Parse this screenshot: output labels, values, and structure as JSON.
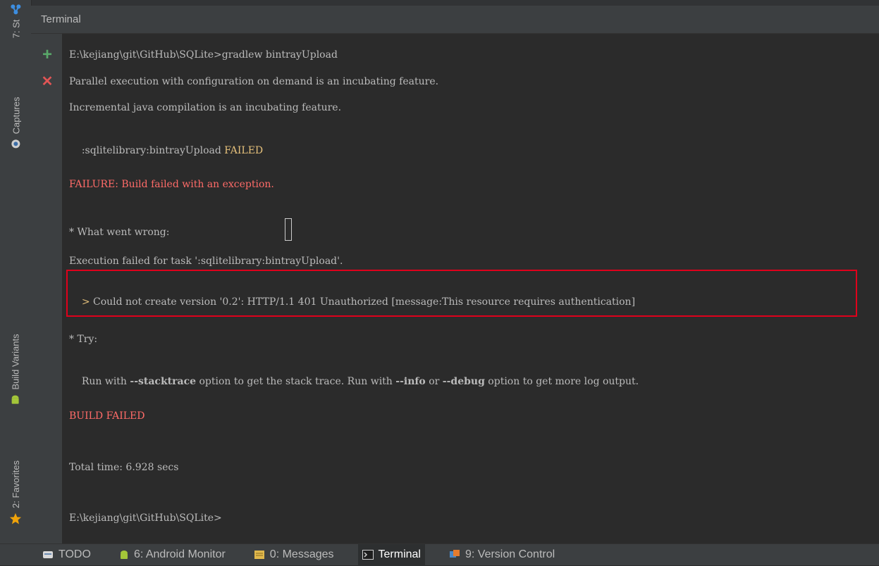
{
  "left_stripe": {
    "structure_tab": "7: St",
    "captures_tab": "Captures",
    "build_variants_tab": "Build Variants",
    "favorites_tab": "2: Favorites"
  },
  "terminal": {
    "title": "Terminal",
    "actions": {
      "new_session": "+",
      "close_session": "✕"
    },
    "lines": {
      "l1": "E:\\kejiang\\git\\GitHub\\SQLite>gradlew bintrayUpload",
      "l2": "Parallel execution with configuration on demand is an incubating feature.",
      "l3": "Incremental java compilation is an incubating feature.",
      "l4_task": ":sqlitelibrary:bintrayUpload ",
      "l4_status": "FAILED",
      "l5": "FAILURE: Build failed with an exception.",
      "l6": "* What went wrong:",
      "l7": "Execution failed for task ':sqlitelibrary:bintrayUpload'.",
      "l8_prefix": "> ",
      "l8": "Could not create version '0.2': HTTP/1.1 401 Unauthorized [message:This resource requires authentication]",
      "l9": "* Try:",
      "l10_a": "Run with ",
      "l10_b": "--stacktrace",
      "l10_c": " option to get the stack trace. Run with ",
      "l10_d": "--info",
      "l10_e": " or ",
      "l10_f": "--debug",
      "l10_g": " option to get more log output.",
      "l11": "BUILD FAILED",
      "l12": "Total time: 6.928 secs",
      "l13": "E:\\kejiang\\git\\GitHub\\SQLite>"
    }
  },
  "bottom_bar": {
    "tabs": [
      {
        "label": "TODO"
      },
      {
        "label": "6: Android Monitor"
      },
      {
        "label": "0: Messages"
      },
      {
        "label": "Terminal"
      },
      {
        "label": "9: Version Control"
      }
    ]
  },
  "colors": {
    "background": "#2b2b2b",
    "panel": "#3c3f41",
    "error_red": "#ff6b68",
    "failed_yellow": "#e5c07b",
    "highlight_box": "#e0001b"
  }
}
